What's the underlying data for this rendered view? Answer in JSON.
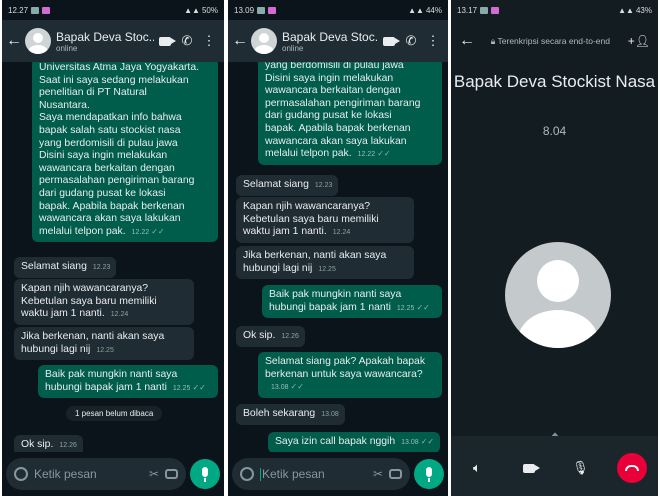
{
  "panel1": {
    "status_time": "12.27",
    "status_right": "50%",
    "contact_name": "Bapak Deva Stoc...",
    "contact_status": "online",
    "messages": [
      {
        "text": "Universitas Atma Jaya Yogyakarta.\nSaat ini saya sedang melakukan\npenelitian di PT Natural\nNusantara.\nSaya mendapatkan info bahwa\nbapak salah satu stockist nasa\nyang berdomisili di pulau jawa\nDisini saya ingin melakukan\nwawancara berkaitan dengan\npermasalahan pengiriman barang\ndari gudang pusat ke lokasi\nbapak. Apabila bapak berkenan\nwawancara akan saya lakukan\nmelalui telpon pak.",
        "time": "12.22"
      },
      {
        "text": "Selamat siang",
        "time": "12.23"
      },
      {
        "text": "Kapan njih wawancaranya?\nKebetulan saya baru memiliki\nwaktu jam 1 nanti.",
        "time": "12.24"
      },
      {
        "text": "Jika berkenan, nanti akan saya\nhubungi lagi nij",
        "time": "12.25"
      },
      {
        "text": "Baik pak mungkin nanti saya\nhubungi bapak jam 1 nanti",
        "time": "12.25"
      },
      {
        "text": "Ok sip.",
        "time": "12.26"
      }
    ],
    "unread_label": "1 pesan belum dibaca",
    "input_placeholder": "Ketik pesan"
  },
  "panel2": {
    "status_time": "13.09",
    "status_right": "44%",
    "contact_name": "Bapak Deva Stoc...",
    "contact_status": "online",
    "messages": [
      {
        "text": "yang berdomisili di pulau jawa\nDisini saya ingin melakukan\nwawancara berkaitan dengan\npermasalahan pengiriman barang\ndari gudang pusat ke lokasi\nbapak. Apabila bapak berkenan\nwawancara akan saya lakukan\nmelalui telpon pak.",
        "time": "12.22"
      },
      {
        "text": "Selamat siang",
        "time": "12.23"
      },
      {
        "text": "Kapan njih wawancaranya?\nKebetulan saya baru memiliki\nwaktu jam 1 nanti.",
        "time": "12.24"
      },
      {
        "text": "Jika berkenan, nanti akan saya\nhubungi lagi nij",
        "time": "12.25"
      },
      {
        "text": "Baik pak mungkin nanti saya\nhubungi bapak jam 1 nanti",
        "time": "12.25"
      },
      {
        "text": "Ok sip.",
        "time": "12.26"
      },
      {
        "text": "Selamat siang pak? Apakah bapak\nberkenan untuk saya wawancara?",
        "time": "13.08"
      },
      {
        "text": "Boleh sekarang",
        "time": "13.08"
      },
      {
        "text": "Saya izin call bapak nggih",
        "time": "13.08"
      }
    ],
    "input_placeholder": "Ketik pesan"
  },
  "panel3": {
    "status_time": "13.17",
    "status_right": "43%",
    "encryption_text": "Terenkripsi secara end-to-end",
    "caller_name": "Bapak Deva Stockist Nasa",
    "call_duration": "8.04"
  }
}
